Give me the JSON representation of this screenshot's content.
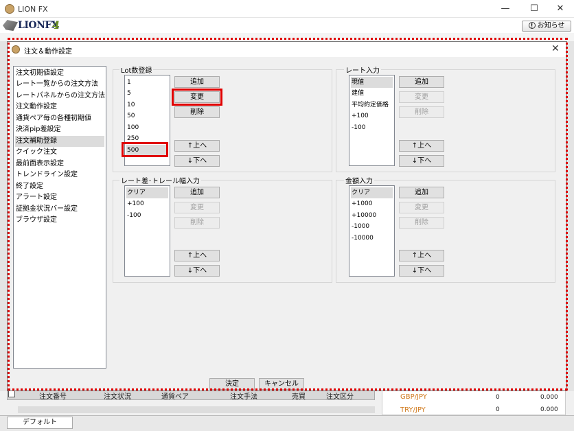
{
  "app": {
    "title": "LION FX",
    "logo_text": "LIONFX",
    "logo_version": "4",
    "notice_label": "お知らせ",
    "notice_mark": "!",
    "min_glyph": "—",
    "max_glyph": "☐",
    "close_glyph": "✕"
  },
  "dialog": {
    "title": "注文＆動作設定",
    "close_glyph": "✕",
    "nav_items": [
      "注文初期値設定",
      "レート一覧からの注文方法",
      "レートパネルからの注文方法",
      "注文動作設定",
      "通貨ペア毎の各種初期値",
      "決済pip差設定",
      "注文補助登録",
      "クイック注文",
      "最前面表示設定",
      "トレンドライン設定",
      "終了設定",
      "アラート設定",
      "証拠金状況バー設定",
      "ブラウザ設定"
    ],
    "selected_nav": "注文補助登録",
    "groups": {
      "lot": {
        "label": "Lot数登録",
        "items": [
          "1",
          "5",
          "10",
          "50",
          "100",
          "250",
          "500"
        ],
        "buttons": {
          "add": "追加",
          "change": "変更",
          "delete": "削除",
          "up": "↑上へ",
          "down": "↓下へ"
        }
      },
      "rate": {
        "label": "レート入力",
        "items": [
          "現値",
          "建値",
          "平均約定価格",
          "+100",
          "-100"
        ],
        "buttons": {
          "add": "追加",
          "change": "変更",
          "delete": "削除",
          "up": "↑上へ",
          "down": "↓下へ"
        }
      },
      "trail": {
        "label": "レート差･トレール幅入力",
        "items": [
          "クリア",
          "+100",
          "-100"
        ],
        "buttons": {
          "add": "追加",
          "change": "変更",
          "delete": "削除",
          "up": "↑上へ",
          "down": "↓下へ"
        }
      },
      "amount": {
        "label": "金額入力",
        "items": [
          "クリア",
          "+1000",
          "+10000",
          "-1000",
          "-10000"
        ],
        "buttons": {
          "add": "追加",
          "change": "変更",
          "delete": "削除",
          "up": "↑上へ",
          "down": "↓下へ"
        }
      }
    },
    "ok_label": "決定",
    "cancel_label": "キャンセル"
  },
  "background": {
    "table_headers": [
      "注文番号",
      "注文状況",
      "通貨ペア",
      "注文手法",
      "売買",
      "注文区分"
    ],
    "rates": [
      {
        "pair": "GBP/JPY",
        "qty": "0",
        "value": "0.000"
      },
      {
        "pair": "TRY/JPY",
        "qty": "0",
        "value": "0.000"
      }
    ],
    "bottom_tab": "デフォルト"
  },
  "colors": {
    "highlight": "#e00000",
    "rate_pair": "#d07a1e",
    "logo_navy": "#1b2a5a",
    "logo_green": "#6a8e22"
  }
}
